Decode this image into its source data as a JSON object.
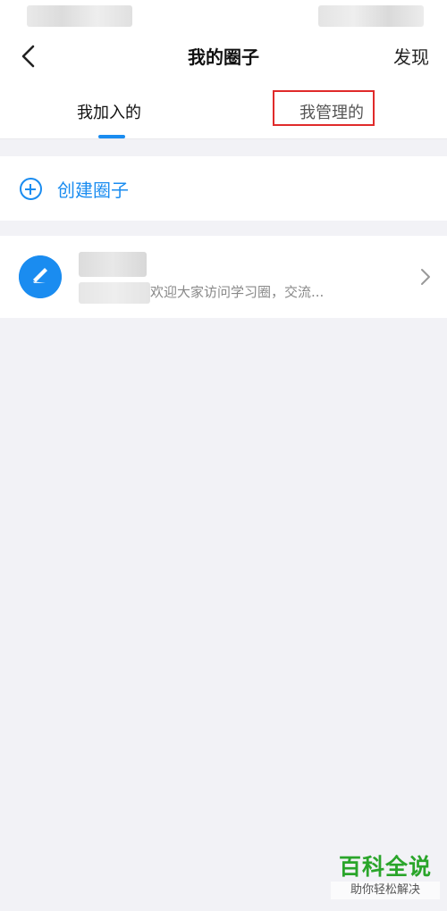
{
  "header": {
    "title": "我的圈子",
    "discover_label": "发现"
  },
  "tabs": [
    {
      "label": "我加入的",
      "active": true
    },
    {
      "label": "我管理的",
      "active": false
    }
  ],
  "create": {
    "label": "创建圈子"
  },
  "circles": [
    {
      "description": "欢迎大家访问学习圈，交流..."
    }
  ],
  "watermark": {
    "title": "百科全说",
    "subtitle": "助你轻松解决"
  },
  "colors": {
    "accent": "#1a8cf0",
    "highlight": "#e02a2a",
    "watermark": "#2aa52a",
    "background": "#f2f2f6"
  },
  "icons": [
    "back-chevron-icon",
    "plus-circle-icon",
    "pencil-icon",
    "chevron-right-icon"
  ]
}
